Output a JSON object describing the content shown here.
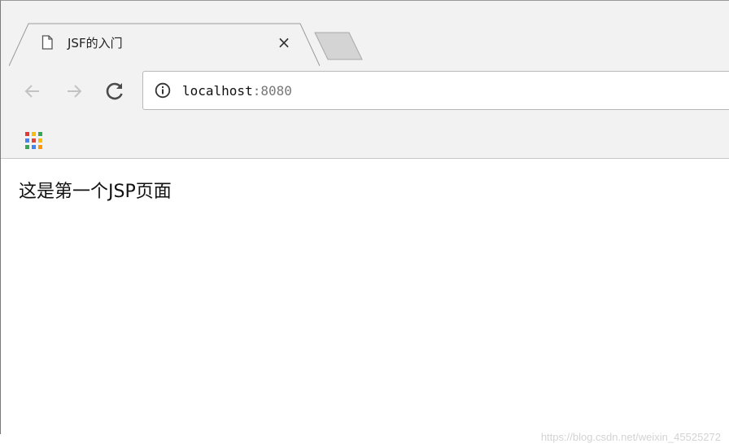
{
  "tab": {
    "title": "JSF的入门",
    "close_label": "×"
  },
  "address_bar": {
    "host": "localhost",
    "port": ":8080"
  },
  "icons": {
    "back": "arrow-left-icon",
    "forward": "arrow-right-icon",
    "reload": "reload-icon",
    "info": "info-icon",
    "apps": "apps-grid-icon",
    "page": "document-icon"
  },
  "apps_colors": [
    "#e53935",
    "#fbbc05",
    "#34a853",
    "#4285f4",
    "#ea4335",
    "#fbbc05",
    "#34a853",
    "#4285f4",
    "#ff9800"
  ],
  "page": {
    "heading": "这是第一个JSP页面"
  },
  "watermark": "https://blog.csdn.net/weixin_45525272"
}
